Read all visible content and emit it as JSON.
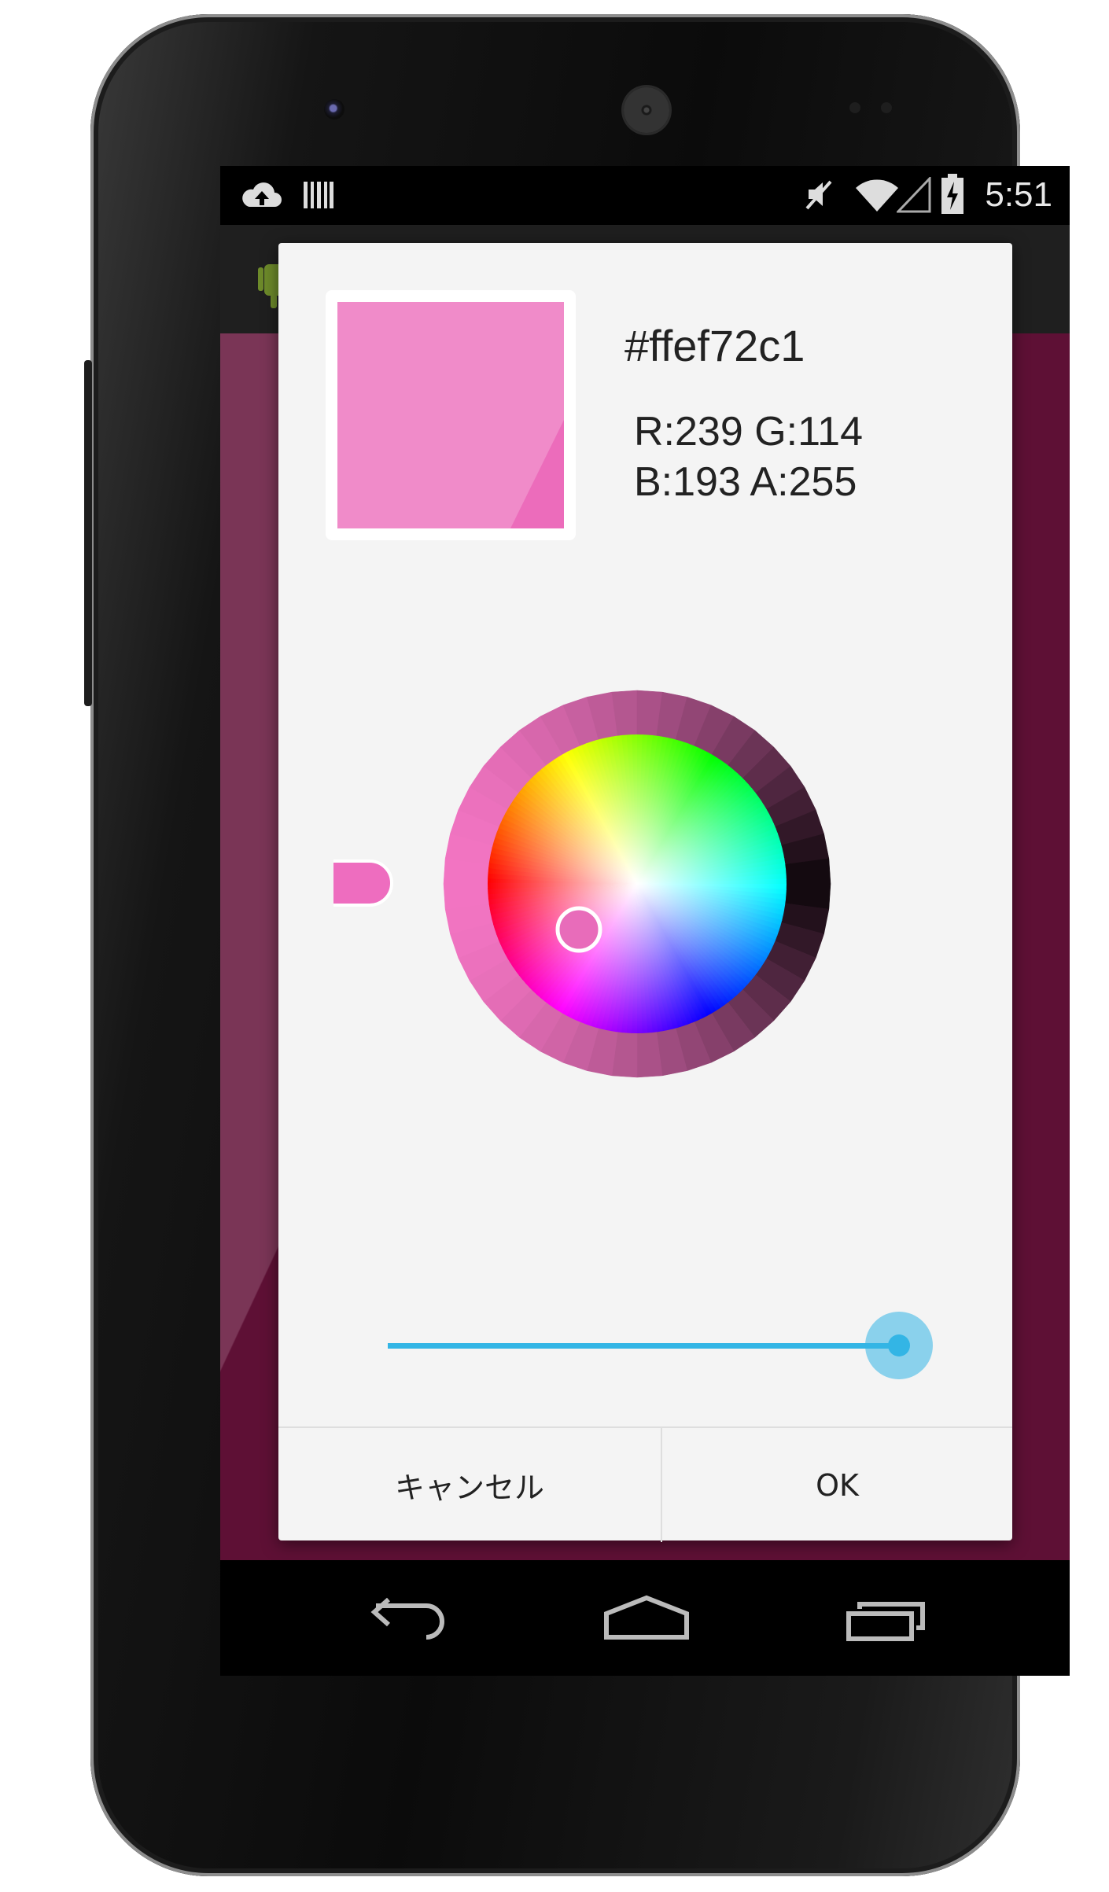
{
  "status_bar": {
    "time": "5:51",
    "icons": [
      "cloud-upload-icon",
      "barcode-icon",
      "mute-icon",
      "wifi-icon",
      "signal-icon",
      "battery-charging-icon"
    ]
  },
  "dialog": {
    "color_hex": "#ffef72c1",
    "rgba_line1": "R:239 G:114",
    "rgba_line2": "B:193 A:255",
    "selected_color": "#ef72c1",
    "alpha_slider_value": 1.0,
    "cancel_label": "キャンセル",
    "ok_label": "OK"
  },
  "nav_bar": {
    "icons": [
      "back-icon",
      "home-icon",
      "recents-icon"
    ]
  },
  "colors": {
    "accent": "#33b5e5",
    "app_background": "#5e1035"
  }
}
